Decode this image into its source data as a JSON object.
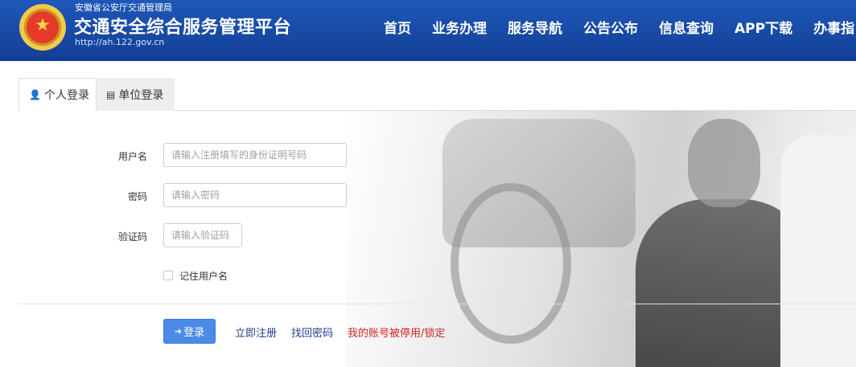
{
  "header": {
    "org": "安徽省公安厅交通管理局",
    "title": "交通安全综合服务管理平台",
    "url": "http://ah.122.gov.cn",
    "brand_color": "#1a4aa8"
  },
  "nav": [
    "首页",
    "业务办理",
    "服务导航",
    "公告公布",
    "信息查询",
    "APP下载",
    "办事指"
  ],
  "tabs": [
    {
      "label": "个人登录",
      "icon": "user-icon",
      "active": true
    },
    {
      "label": "单位登录",
      "icon": "building-icon",
      "active": false
    }
  ],
  "form": {
    "username_label": "用户名",
    "username_placeholder": "请输入注册填写的身份证明号码",
    "password_label": "密码",
    "password_placeholder": "请输入密码",
    "captcha_label": "验证码",
    "captcha_placeholder": "请输入验证码",
    "remember_label": "记住用户名"
  },
  "actions": {
    "login": "登录",
    "register": "立即注册",
    "recover": "找回密码",
    "locked": "我的账号被停用/锁定"
  }
}
